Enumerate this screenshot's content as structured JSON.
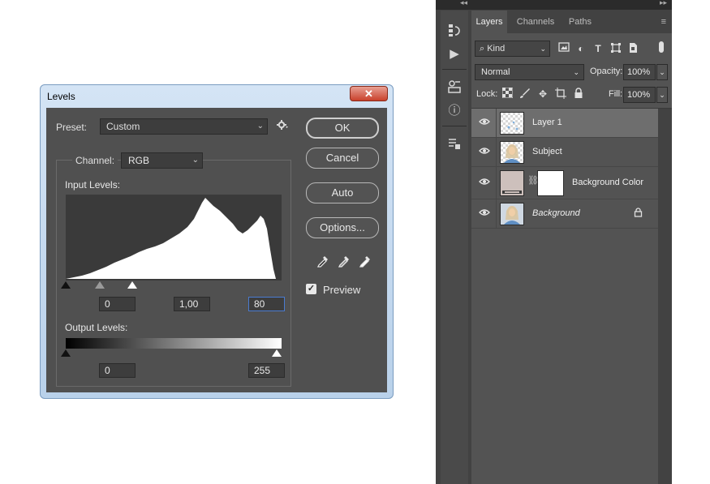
{
  "levels_dialog": {
    "title": "Levels",
    "close_glyph": "✕",
    "preset_label": "Preset:",
    "preset_value": "Custom",
    "channel_label": "Channel:",
    "channel_value": "RGB",
    "input_levels_label": "Input Levels:",
    "input_black": "0",
    "input_mid": "1,00",
    "input_white": "80",
    "output_levels_label": "Output Levels:",
    "output_black": "0",
    "output_white": "255",
    "buttons": {
      "ok": "OK",
      "cancel": "Cancel",
      "auto": "Auto",
      "options": "Options..."
    },
    "preview_label": "Preview",
    "preview_checked": true,
    "icons": [
      "gear-icon",
      "black-eyedropper-icon",
      "gray-eyedropper-icon",
      "white-eyedropper-icon"
    ]
  },
  "layers_panel": {
    "tabs": [
      "Layers",
      "Channels",
      "Paths"
    ],
    "active_tab": "Layers",
    "filter_kind": "Kind",
    "blend_mode": "Normal",
    "opacity_label": "Opacity:",
    "opacity_value": "100%",
    "lock_label": "Lock:",
    "fill_label": "Fill:",
    "fill_value": "100%",
    "layers": [
      {
        "name": "Layer 1",
        "selected": true,
        "visible": true
      },
      {
        "name": "Subject",
        "selected": false,
        "visible": true
      },
      {
        "name": "Background Color",
        "selected": false,
        "visible": true,
        "has_mask": true
      },
      {
        "name": "Background",
        "selected": false,
        "visible": true,
        "locked": true
      }
    ]
  },
  "colors": {
    "panel_bg": "#535353",
    "dialog_frame": "#b9d1ea",
    "close_button": "#c9412c",
    "selected_layer": "#6e6e6e"
  }
}
